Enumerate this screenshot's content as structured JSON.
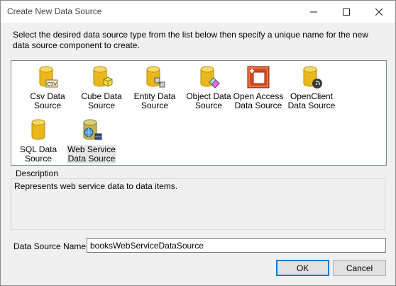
{
  "window": {
    "title": "Create New Data Source"
  },
  "instructions": "Select the desired data source type from the list below then specify a unique name for the new data source component to create.",
  "items": [
    {
      "line1": "Csv Data",
      "line2": "Source",
      "icon": "csv-database-icon"
    },
    {
      "line1": "Cube Data",
      "line2": "Source",
      "icon": "cube-database-icon"
    },
    {
      "line1": "Entity Data",
      "line2": "Source",
      "icon": "entity-database-icon"
    },
    {
      "line1": "Object Data",
      "line2": "Source",
      "icon": "object-database-icon"
    },
    {
      "line1": "Open Access",
      "line2": "Data Source",
      "icon": "open-access-icon"
    },
    {
      "line1": "OpenClient",
      "line2": "Data Source",
      "icon": "openclient-database-icon"
    },
    {
      "line1": "SQL Data",
      "line2": "Source",
      "icon": "sql-database-icon"
    },
    {
      "line1": "Web Service",
      "line2": "Data Source",
      "icon": "web-service-database-icon",
      "selected": true
    }
  ],
  "description": {
    "title": "Description",
    "text": "Represents web service data to data items."
  },
  "name_field": {
    "label": "Data Source Name:",
    "value": "booksWebServiceDataSource"
  },
  "buttons": {
    "ok": "OK",
    "cancel": "Cancel"
  },
  "colors": {
    "accent": "#0078d7",
    "database_gold": "#e8b81c",
    "open_access_red": "#d64a1f"
  }
}
